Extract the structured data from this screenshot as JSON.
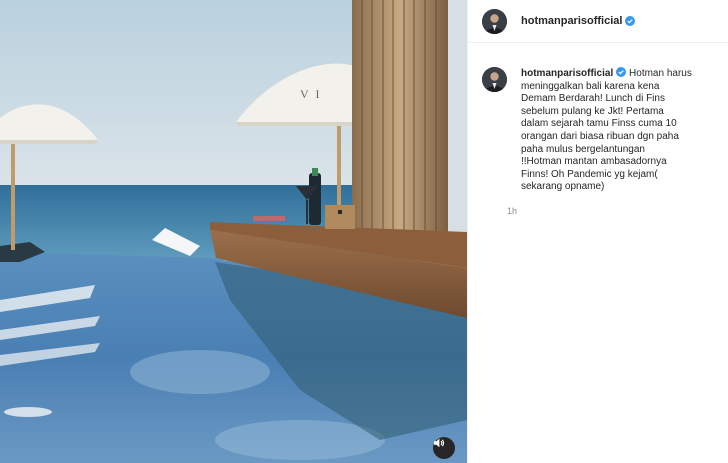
{
  "post": {
    "username": "hotmanparisofficial",
    "verified_icon": "verified-badge-icon",
    "caption_lines": "Hotman harus\nmeninggalkan bali karena kena\nDemam Berdarah! Lunch di Fins\nsebelum pulang ke Jkt! Pertama\ndalam sejarah tamu Finss cuma 10\norangan dari biasa ribuan dgn paha\npaha mulus bergelantungan\n!!Hotman mantan ambasadornya\nFinns! Oh Pandemic yg kejam(\nsekarang opname)",
    "timestamp": "1h"
  },
  "media": {
    "description_icon": "pool-video",
    "sound_icon": "speaker-icon"
  },
  "colors": {
    "verified": "#3897f0",
    "sound_button": "#262626",
    "pool_water": "#4d84b8",
    "sea": "#2f6f9a"
  }
}
